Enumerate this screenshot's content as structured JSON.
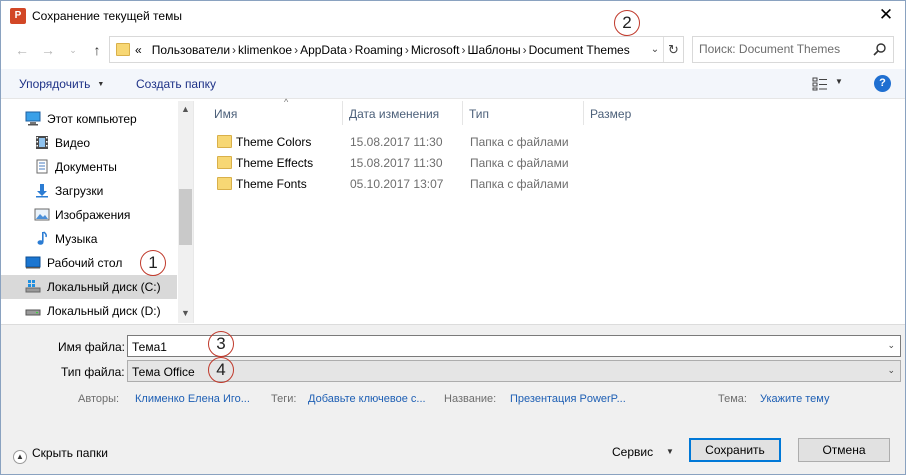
{
  "window": {
    "title": "Сохранение текущей темы",
    "app_icon": "P",
    "close": "✕"
  },
  "address": {
    "prefix": "«",
    "crumbs": [
      "Пользователи",
      "klimenkoe",
      "AppData",
      "Roaming",
      "Microsoft",
      "Шаблоны",
      "Document Themes"
    ],
    "separator": "›"
  },
  "search": {
    "placeholder": "Поиск: Document Themes"
  },
  "toolbar": {
    "organize": "Упорядочить",
    "new_folder": "Создать папку",
    "help": "?"
  },
  "badges": [
    "1",
    "2",
    "3",
    "4"
  ],
  "nav": {
    "items": [
      {
        "label": "Этот компьютер",
        "icon": "computer-icon"
      },
      {
        "label": "Видео",
        "icon": "video-icon"
      },
      {
        "label": "Документы",
        "icon": "documents-icon"
      },
      {
        "label": "Загрузки",
        "icon": "downloads-icon"
      },
      {
        "label": "Изображения",
        "icon": "pictures-icon"
      },
      {
        "label": "Музыка",
        "icon": "music-icon"
      },
      {
        "label": "Рабочий стол",
        "icon": "desktop-icon"
      },
      {
        "label": "Локальный диск (C:)",
        "icon": "drive-icon"
      },
      {
        "label": "Локальный диск (D:)",
        "icon": "drive-icon"
      }
    ]
  },
  "columns": {
    "name": "Имя",
    "date": "Дата изменения",
    "type": "Тип",
    "size": "Размер"
  },
  "files": [
    {
      "name": "Theme Colors",
      "date": "15.08.2017 11:30",
      "type": "Папка с файлами"
    },
    {
      "name": "Theme Effects",
      "date": "15.08.2017 11:30",
      "type": "Папка с файлами"
    },
    {
      "name": "Theme Fonts",
      "date": "05.10.2017 13:07",
      "type": "Папка с файлами"
    }
  ],
  "form": {
    "filename_label": "Имя файла:",
    "filename_value": "Тема1",
    "filetype_label": "Тип файла:",
    "filetype_value": "Тема Office"
  },
  "meta": {
    "authors_label": "Авторы:",
    "authors_value": "Клименко Елена Иго...",
    "tags_label": "Теги:",
    "tags_value": "Добавьте ключевое с...",
    "title_label": "Название:",
    "title_value": "Презентация PowerP...",
    "theme_label": "Тема:",
    "theme_value": "Укажите тему"
  },
  "footer": {
    "hide_folders": "Скрыть папки",
    "service": "Сервис",
    "save": "Сохранить",
    "cancel": "Отмена"
  },
  "colors": {
    "accent": "#0078d7",
    "badge_ring": "#c0392b",
    "link": "#1e5fb4"
  }
}
